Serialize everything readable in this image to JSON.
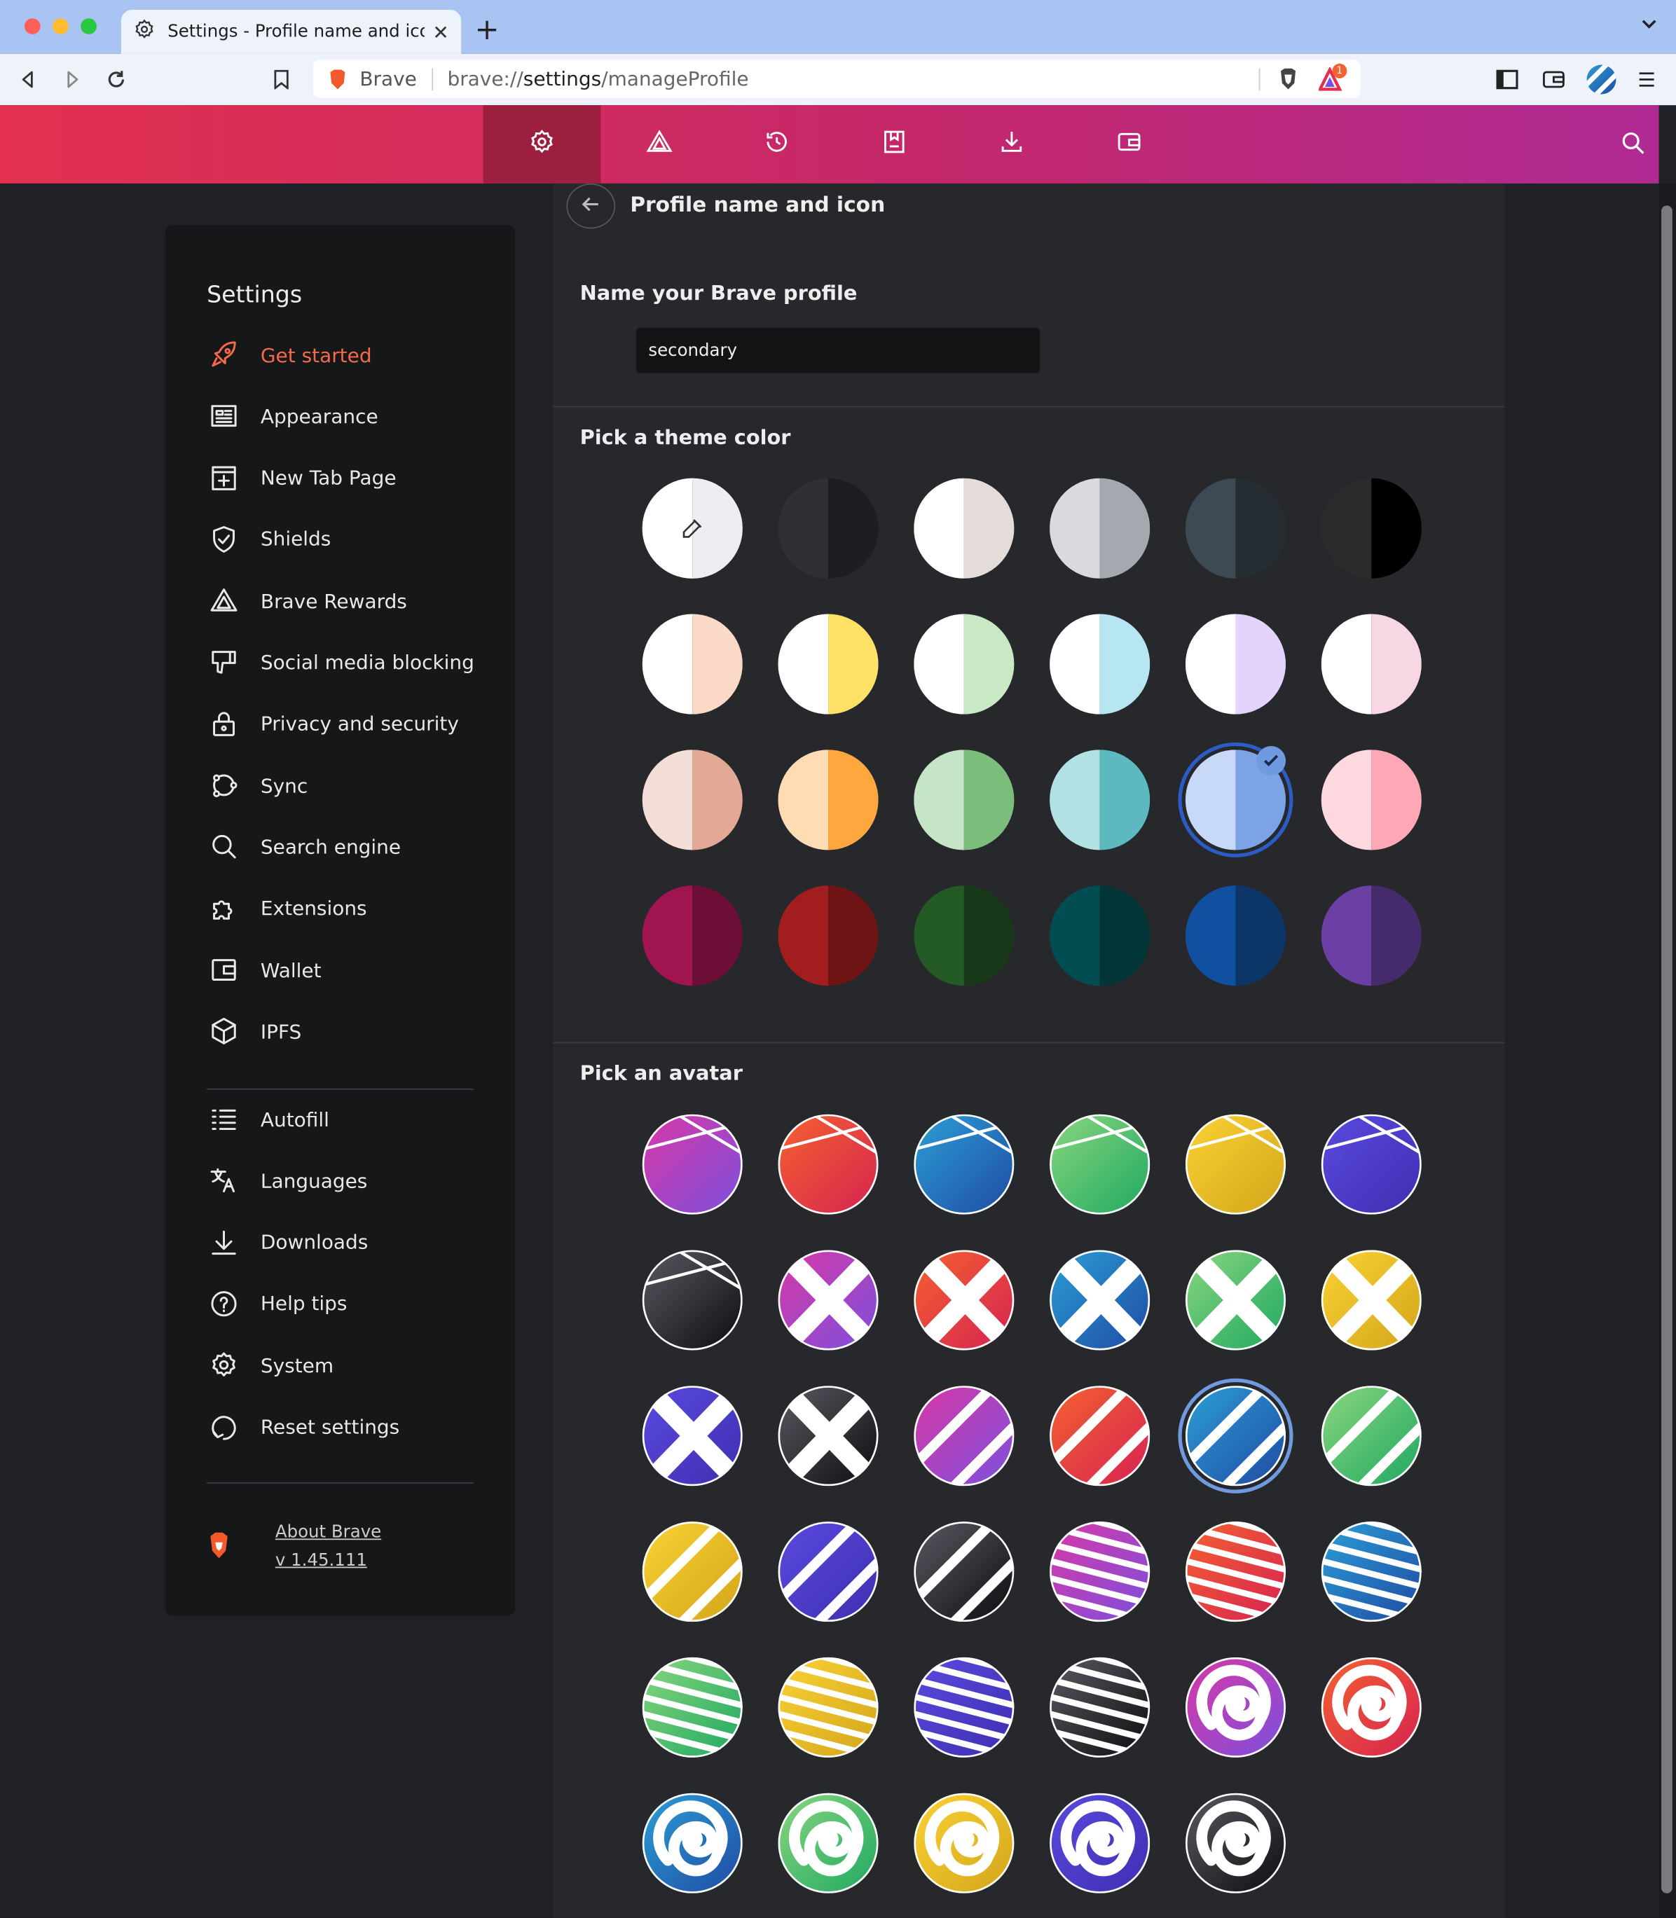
{
  "window": {
    "tab_title": "Settings - Profile name and icon",
    "traffic": [
      "#fe5f57",
      "#febc2e",
      "#28c840"
    ]
  },
  "toolbar": {
    "brand_label": "Brave",
    "url_prefix": "brave://",
    "url_host": "settings",
    "url_path": "/manageProfile",
    "rewards_badge": "1"
  },
  "header_nav": {
    "items": [
      "settings-icon",
      "rewards-icon",
      "history-icon",
      "bookmarks-icon",
      "downloads-icon",
      "wallet-icon"
    ],
    "active_index": 0,
    "gradient": [
      "#e3304f",
      "#b02a94"
    ]
  },
  "sidebar": {
    "title": "Settings",
    "items": [
      {
        "label": "Get started",
        "icon": "rocket-icon",
        "active": true
      },
      {
        "label": "Appearance",
        "icon": "appearance-icon"
      },
      {
        "label": "New Tab Page",
        "icon": "new-tab-icon"
      },
      {
        "label": "Shields",
        "icon": "shield-icon"
      },
      {
        "label": "Brave Rewards",
        "icon": "rewards-icon"
      },
      {
        "label": "Social media blocking",
        "icon": "thumbs-down-icon"
      },
      {
        "label": "Privacy and security",
        "icon": "lock-icon"
      },
      {
        "label": "Sync",
        "icon": "sync-icon"
      },
      {
        "label": "Search engine",
        "icon": "search-icon"
      },
      {
        "label": "Extensions",
        "icon": "puzzle-icon"
      },
      {
        "label": "Wallet",
        "icon": "wallet-icon"
      },
      {
        "label": "IPFS",
        "icon": "cube-icon"
      }
    ],
    "items2": [
      {
        "label": "Autofill",
        "icon": "list-icon"
      },
      {
        "label": "Languages",
        "icon": "translate-icon"
      },
      {
        "label": "Downloads",
        "icon": "download-icon"
      },
      {
        "label": "Help tips",
        "icon": "help-icon"
      },
      {
        "label": "System",
        "icon": "gear-icon"
      },
      {
        "label": "Reset settings",
        "icon": "reset-icon"
      }
    ],
    "about_link": "About Brave",
    "version": "v 1.45.111"
  },
  "main": {
    "page_title": "Profile name and icon",
    "name_section_title": "Name your Brave profile",
    "profile_name": "secondary",
    "theme_section_title": "Pick a theme color",
    "avatar_section_title": "Pick an avatar",
    "theme_colors": [
      [
        "#ffffff",
        "#eceef2"
      ],
      [
        "#2f3033",
        "#1d1e21"
      ],
      [
        "#ffffff",
        "#e3dcd8"
      ],
      [
        "#d8dadf",
        "#a4a8b1"
      ],
      [
        "#3d4a54",
        "#252d33"
      ],
      [
        "#2b2b2b",
        "#000000"
      ],
      [
        "#ffffff",
        "#fbd9c7"
      ],
      [
        "#ffffff",
        "#fee167"
      ],
      [
        "#ffffff",
        "#cbe8c4"
      ],
      [
        "#ffffff",
        "#b5e6f2"
      ],
      [
        "#ffffff",
        "#e4d4fb"
      ],
      [
        "#ffffff",
        "#f7d7e4"
      ],
      [
        "#f3ded7",
        "#e2aa96"
      ],
      [
        "#ffdcb3",
        "#fea73f"
      ],
      [
        "#c6e5c6",
        "#7bbe7c"
      ],
      [
        "#b2e1e4",
        "#5cb9bf"
      ],
      [
        "#c7d9f7",
        "#7ca3e6"
      ],
      [
        "#fed8df",
        "#fea7b5"
      ],
      [
        "#a01450",
        "#6d0e37"
      ],
      [
        "#a21e1e",
        "#6e1414"
      ],
      [
        "#245a25",
        "#17391a"
      ],
      [
        "#024d52",
        "#013538"
      ],
      [
        "#1150a0",
        "#0c3668"
      ],
      [
        "#6b3fa3",
        "#452a6c"
      ]
    ],
    "selected_theme_index": 16,
    "avatars": [
      {
        "pattern": "cross-lines",
        "colors": [
          "#d938a6",
          "#7b50de"
        ]
      },
      {
        "pattern": "cross-lines",
        "colors": [
          "#f4622f",
          "#d62252"
        ]
      },
      {
        "pattern": "cross-lines",
        "colors": [
          "#2b9fd6",
          "#204aa3"
        ]
      },
      {
        "pattern": "cross-lines",
        "colors": [
          "#8ad67e",
          "#1ea861"
        ]
      },
      {
        "pattern": "cross-lines",
        "colors": [
          "#fbd234",
          "#d2a51a"
        ]
      },
      {
        "pattern": "cross-lines",
        "colors": [
          "#5a4ae0",
          "#3d2fb0"
        ]
      },
      {
        "pattern": "cross-lines",
        "colors": [
          "#5a5b63",
          "#0c0c0e"
        ]
      },
      {
        "pattern": "x",
        "colors": [
          "#d938a6",
          "#7b50de"
        ]
      },
      {
        "pattern": "x",
        "colors": [
          "#f4622f",
          "#d62252"
        ]
      },
      {
        "pattern": "x",
        "colors": [
          "#2b9fd6",
          "#204aa3"
        ]
      },
      {
        "pattern": "x",
        "colors": [
          "#8ad67e",
          "#1ea861"
        ]
      },
      {
        "pattern": "x",
        "colors": [
          "#fbd234",
          "#d2a51a"
        ]
      },
      {
        "pattern": "x",
        "colors": [
          "#5a4ae0",
          "#3d2fb0"
        ]
      },
      {
        "pattern": "x",
        "colors": [
          "#5a5b63",
          "#0c0c0e"
        ]
      },
      {
        "pattern": "diag",
        "colors": [
          "#d938a6",
          "#7b50de"
        ]
      },
      {
        "pattern": "diag",
        "colors": [
          "#f4622f",
          "#d62252"
        ]
      },
      {
        "pattern": "diag",
        "colors": [
          "#2b9fd6",
          "#204aa3"
        ]
      },
      {
        "pattern": "diag",
        "colors": [
          "#8ad67e",
          "#1ea861"
        ]
      },
      {
        "pattern": "diag",
        "colors": [
          "#fbd234",
          "#d2a51a"
        ]
      },
      {
        "pattern": "diag",
        "colors": [
          "#5a4ae0",
          "#3d2fb0"
        ]
      },
      {
        "pattern": "diag",
        "colors": [
          "#5a5b63",
          "#0c0c0e"
        ]
      },
      {
        "pattern": "stripes",
        "colors": [
          "#d938a6",
          "#7b50de"
        ]
      },
      {
        "pattern": "stripes",
        "colors": [
          "#f4622f",
          "#d62252"
        ]
      },
      {
        "pattern": "stripes",
        "colors": [
          "#2b9fd6",
          "#204aa3"
        ]
      },
      {
        "pattern": "stripes",
        "colors": [
          "#8ad67e",
          "#1ea861"
        ]
      },
      {
        "pattern": "stripes",
        "colors": [
          "#fbd234",
          "#d2a51a"
        ]
      },
      {
        "pattern": "stripes",
        "colors": [
          "#5a4ae0",
          "#3d2fb0"
        ]
      },
      {
        "pattern": "stripes",
        "colors": [
          "#5a5b63",
          "#0c0c0e"
        ]
      },
      {
        "pattern": "spiral",
        "colors": [
          "#d938a6",
          "#7b50de"
        ]
      },
      {
        "pattern": "spiral",
        "colors": [
          "#f4622f",
          "#d62252"
        ]
      },
      {
        "pattern": "spiral",
        "colors": [
          "#2b9fd6",
          "#204aa3"
        ]
      },
      {
        "pattern": "spiral",
        "colors": [
          "#8ad67e",
          "#1ea861"
        ]
      },
      {
        "pattern": "spiral",
        "colors": [
          "#fbd234",
          "#d2a51a"
        ]
      },
      {
        "pattern": "spiral",
        "colors": [
          "#5a4ae0",
          "#3d2fb0"
        ]
      },
      {
        "pattern": "spiral",
        "colors": [
          "#5a5b63",
          "#0c0c0e"
        ]
      }
    ],
    "selected_avatar_index": 16
  }
}
